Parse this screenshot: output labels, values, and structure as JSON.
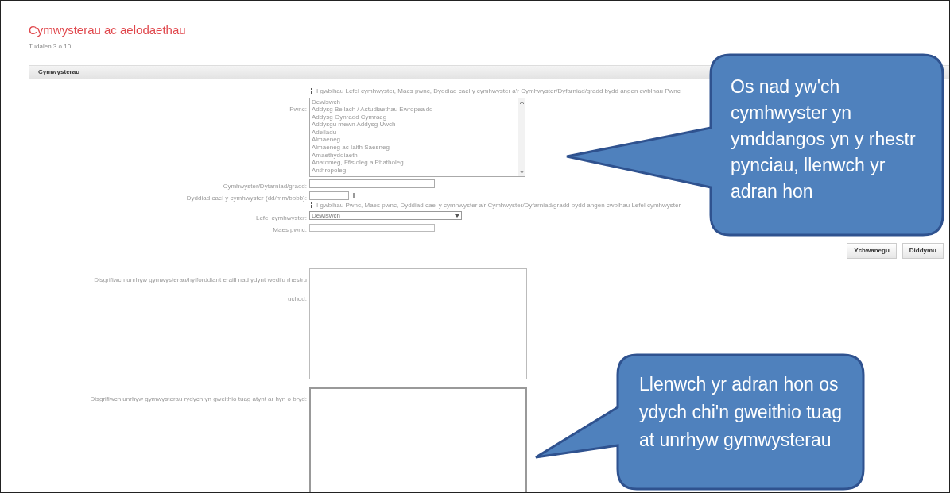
{
  "page": {
    "title": "Cymwysterau ac aelodaethau",
    "subtitle": "Tudalen 3 o 10"
  },
  "section": {
    "title": "Cymwysterau"
  },
  "form": [
    {
      "kind": "info",
      "text": "I gwblhau Lefel cymhwyster, Maes pwnc, Dyddiad cael y cymhwyster a'r Cymhwyster/Dyfarniad/gradd bydd angen cwblhau Pwnc"
    },
    {
      "kind": "listbox",
      "label": "Pwnc:",
      "options": [
        "Dewiswch",
        "Addysg Bellach / Astudiaethau Ewropeaidd",
        "Addysg Gynradd Cymraeg",
        "Addysgu mewn Addysg Uwch",
        "Adeiladu",
        "Almaeneg",
        "Almaeneg ac Iaith Saesneg",
        "Amaethyddiaeth",
        "Anatomeg, Ffisioleg a Phatholeg",
        "Anthropoleg"
      ]
    },
    {
      "kind": "text",
      "label": "Cymhwyster/Dyfarniad/gradd:"
    },
    {
      "kind": "date",
      "label": "Dyddiad cael y cymhwyster (dd/mm/bbbb):"
    },
    {
      "kind": "info",
      "text": "I gwblhau Pwnc, Maes pwnc, Dyddiad cael y cymhwyster a'r Cymhwyster/Dyfarniad/gradd bydd angen cwblhau Lefel cymhwyster"
    },
    {
      "kind": "select",
      "label": "Lefel cymhwyster:",
      "value": "Dewiswch"
    },
    {
      "kind": "short",
      "label": "Maes pwnc:"
    }
  ],
  "buttons": [
    "Ychwanegu",
    "Diddymu"
  ],
  "textareas": [
    {
      "label": "Disgrifiwch unrhyw gymwysterau/hyfforddiant eraill nad ydynt wedi'u rhestru uchod:"
    },
    {
      "label": "Disgrifiwch unrhyw gymwysterau rydych yn gweithio tuag atynt ar hyn o bryd:"
    }
  ],
  "callouts": [
    "Os nad yw'ch cymhwyster yn ymddangos yn y rhestr pynciau, llenwch yr adran hon",
    "Llenwch yr adran hon os ydych chi'n gweithio tuag at unrhyw gymwysterau"
  ]
}
